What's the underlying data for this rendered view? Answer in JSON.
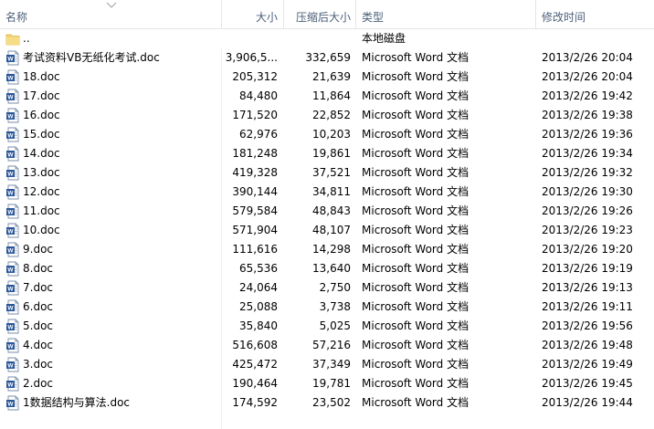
{
  "columns": {
    "name": "名称",
    "size": "大小",
    "compressed": "压缩后大小",
    "type": "类型",
    "modified": "修改时间"
  },
  "parent": {
    "name": "..",
    "type": "本地磁盘",
    "icon": "folder-icon"
  },
  "files": [
    {
      "name": "考试资料VB无纸化考试.doc",
      "size": "3,906,5...",
      "compressed": "332,659",
      "type": "Microsoft Word 文档",
      "modified": "2013/2/26 20:04",
      "icon": "word-doc-icon"
    },
    {
      "name": "18.doc",
      "size": "205,312",
      "compressed": "21,639",
      "type": "Microsoft Word 文档",
      "modified": "2013/2/26 20:04",
      "icon": "word-doc-icon"
    },
    {
      "name": "17.doc",
      "size": "84,480",
      "compressed": "11,864",
      "type": "Microsoft Word 文档",
      "modified": "2013/2/26 19:42",
      "icon": "word-doc-icon"
    },
    {
      "name": "16.doc",
      "size": "171,520",
      "compressed": "22,852",
      "type": "Microsoft Word 文档",
      "modified": "2013/2/26 19:38",
      "icon": "word-doc-icon"
    },
    {
      "name": "15.doc",
      "size": "62,976",
      "compressed": "10,203",
      "type": "Microsoft Word 文档",
      "modified": "2013/2/26 19:36",
      "icon": "word-doc-icon"
    },
    {
      "name": "14.doc",
      "size": "181,248",
      "compressed": "19,861",
      "type": "Microsoft Word 文档",
      "modified": "2013/2/26 19:34",
      "icon": "word-doc-icon"
    },
    {
      "name": "13.doc",
      "size": "419,328",
      "compressed": "37,521",
      "type": "Microsoft Word 文档",
      "modified": "2013/2/26 19:32",
      "icon": "word-doc-icon"
    },
    {
      "name": "12.doc",
      "size": "390,144",
      "compressed": "34,811",
      "type": "Microsoft Word 文档",
      "modified": "2013/2/26 19:30",
      "icon": "word-doc-icon"
    },
    {
      "name": "11.doc",
      "size": "579,584",
      "compressed": "48,843",
      "type": "Microsoft Word 文档",
      "modified": "2013/2/26 19:26",
      "icon": "word-doc-icon"
    },
    {
      "name": "10.doc",
      "size": "571,904",
      "compressed": "48,107",
      "type": "Microsoft Word 文档",
      "modified": "2013/2/26 19:23",
      "icon": "word-doc-icon"
    },
    {
      "name": "9.doc",
      "size": "111,616",
      "compressed": "14,298",
      "type": "Microsoft Word 文档",
      "modified": "2013/2/26 19:20",
      "icon": "word-doc-icon"
    },
    {
      "name": "8.doc",
      "size": "65,536",
      "compressed": "13,640",
      "type": "Microsoft Word 文档",
      "modified": "2013/2/26 19:19",
      "icon": "word-doc-icon"
    },
    {
      "name": "7.doc",
      "size": "24,064",
      "compressed": "2,750",
      "type": "Microsoft Word 文档",
      "modified": "2013/2/26 19:13",
      "icon": "word-doc-icon"
    },
    {
      "name": "6.doc",
      "size": "25,088",
      "compressed": "3,738",
      "type": "Microsoft Word 文档",
      "modified": "2013/2/26 19:11",
      "icon": "word-doc-icon"
    },
    {
      "name": "5.doc",
      "size": "35,840",
      "compressed": "5,025",
      "type": "Microsoft Word 文档",
      "modified": "2013/2/26 19:56",
      "icon": "word-doc-icon"
    },
    {
      "name": "4.doc",
      "size": "516,608",
      "compressed": "57,216",
      "type": "Microsoft Word 文档",
      "modified": "2013/2/26 19:48",
      "icon": "word-doc-icon"
    },
    {
      "name": "3.doc",
      "size": "425,472",
      "compressed": "37,349",
      "type": "Microsoft Word 文档",
      "modified": "2013/2/26 19:49",
      "icon": "word-doc-icon"
    },
    {
      "name": "2.doc",
      "size": "190,464",
      "compressed": "19,781",
      "type": "Microsoft Word 文档",
      "modified": "2013/2/26 19:45",
      "icon": "word-doc-icon"
    },
    {
      "name": "1数据结构与算法.doc",
      "size": "174,592",
      "compressed": "23,502",
      "type": "Microsoft Word 文档",
      "modified": "2013/2/26 19:44",
      "icon": "word-doc-icon"
    }
  ],
  "colors": {
    "header_text": "#4c607a",
    "grid_line": "#e5e5e5",
    "word_blue": "#2b579a",
    "folder_yellow": "#f3d16e"
  }
}
